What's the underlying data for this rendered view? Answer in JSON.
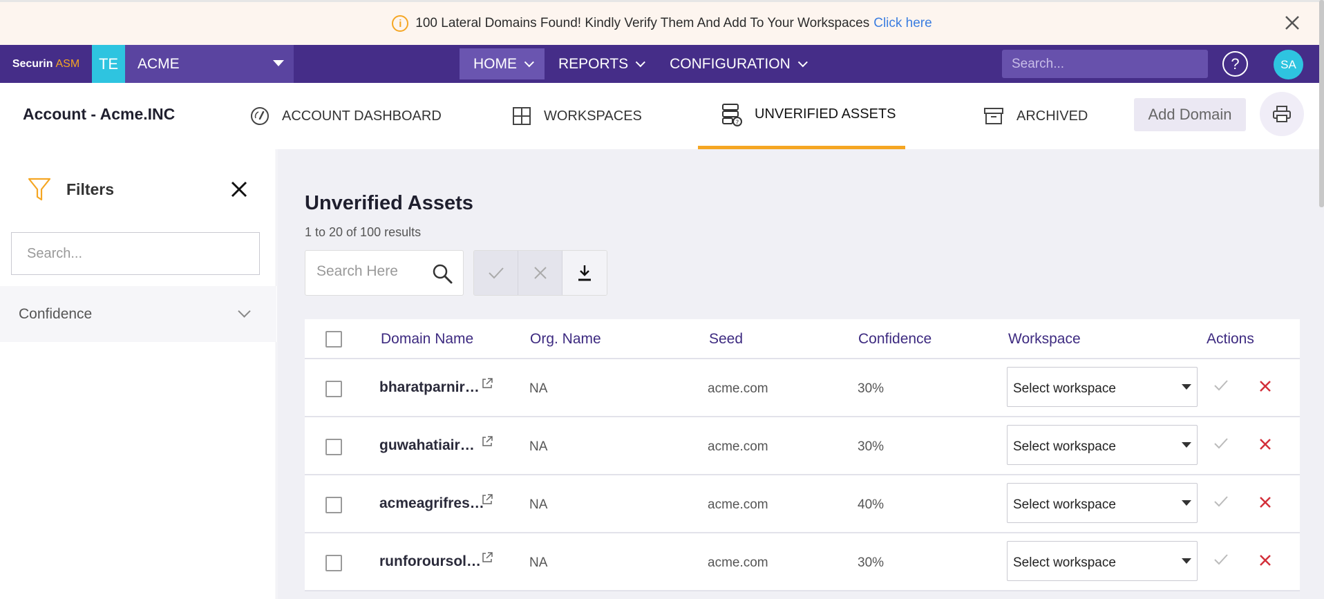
{
  "banner": {
    "message": "100 Lateral Domains Found! Kindly Verify Them And Add To Your Workspaces",
    "link": "Click here",
    "info_icon": "info-icon",
    "close_icon": "close-icon"
  },
  "topnav": {
    "brand_prefix": "Securin",
    "brand_suffix": "ASM",
    "tenant_badge": "TE",
    "tenant_name": "ACME",
    "menu": [
      {
        "label": "HOME"
      },
      {
        "label": "REPORTS"
      },
      {
        "label": "CONFIGURATION"
      }
    ],
    "search_placeholder": "Search...",
    "help_label": "?",
    "avatar_initials": "SA"
  },
  "subheader": {
    "account_title": "Account - Acme.INC",
    "tabs": [
      {
        "label": "ACCOUNT DASHBOARD",
        "icon": "gauge-icon"
      },
      {
        "label": "WORKSPACES",
        "icon": "grid-icon"
      },
      {
        "label": "UNVERIFIED ASSETS",
        "icon": "server-question-icon"
      },
      {
        "label": "ARCHIVED",
        "icon": "archive-box-icon"
      }
    ],
    "add_domain": "Add Domain",
    "print_icon": "printer-icon"
  },
  "sidebar": {
    "title": "Filters",
    "search_placeholder": "Search...",
    "sections": [
      {
        "label": "Confidence"
      }
    ]
  },
  "main": {
    "title": "Unverified Assets",
    "results": "1 to 20 of 100 results",
    "search_placeholder": "Search Here",
    "columns": {
      "domain": "Domain Name",
      "org": "Org. Name",
      "seed": "Seed",
      "confidence": "Confidence",
      "workspace": "Workspace",
      "actions": "Actions"
    },
    "rows": [
      {
        "domain": "bharatparnir…",
        "org": "NA",
        "seed": "acme.com",
        "confidence": "30%",
        "workspace": "Select workspace"
      },
      {
        "domain": "guwahatiair…",
        "org": "NA",
        "seed": "acme.com",
        "confidence": "30%",
        "workspace": "Select workspace"
      },
      {
        "domain": "acmeagrifres…",
        "org": "NA",
        "seed": "acme.com",
        "confidence": "40%",
        "workspace": "Select workspace"
      },
      {
        "domain": "runforoursol…",
        "org": "NA",
        "seed": "acme.com",
        "confidence": "30%",
        "workspace": "Select workspace"
      }
    ]
  },
  "colors": {
    "nav_bg": "#452d88",
    "accent": "#f5a623",
    "tenant": "#2ec4e0",
    "header_text": "#3d2a80",
    "reject": "#d32f3a"
  }
}
